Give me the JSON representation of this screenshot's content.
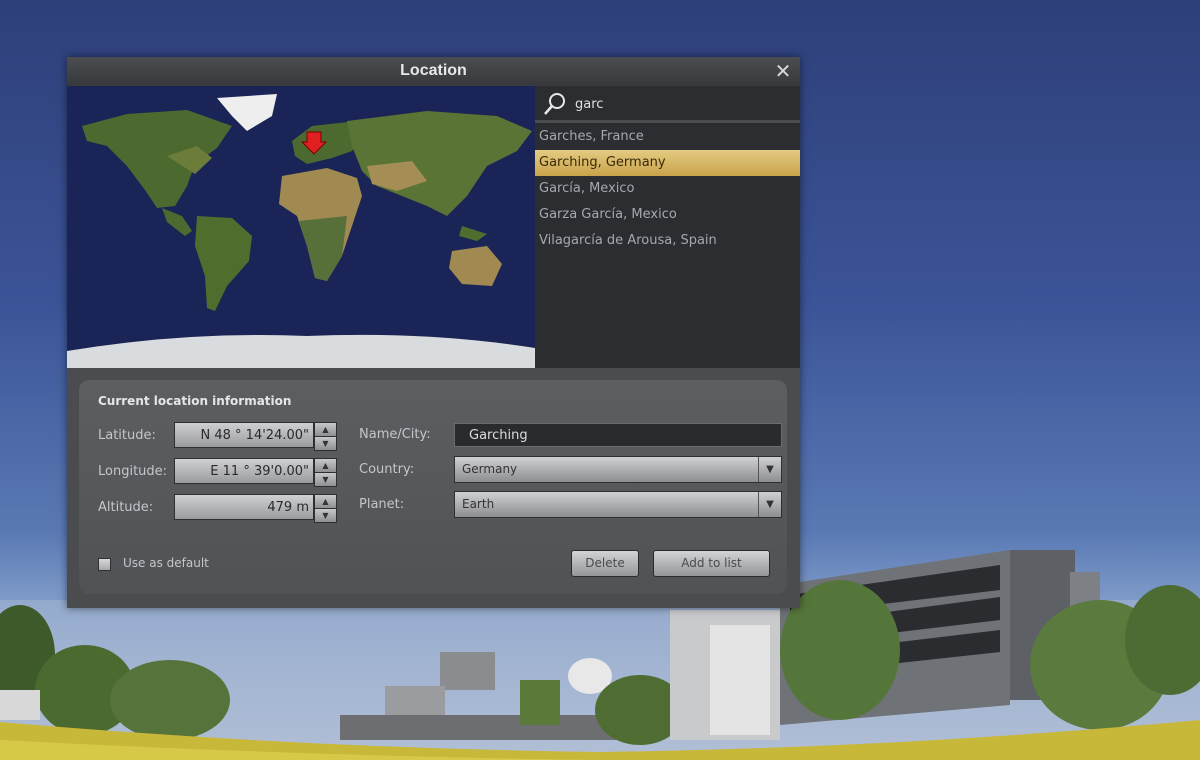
{
  "dialog": {
    "title": "Location",
    "close_glyph": "✕"
  },
  "search": {
    "query": "garc",
    "results": [
      "Garches, France",
      "Garching, Germany",
      "García, Mexico",
      "Garza García, Mexico",
      "Vilagarcía de Arousa, Spain"
    ],
    "selected_result": "Garching, Germany"
  },
  "info": {
    "group_title": "Current location information",
    "latitude_label": "Latitude:",
    "latitude_value": "N 48 ° 14'24.00\"",
    "longitude_label": "Longitude:",
    "longitude_value": "E 11 ° 39'0.00\"",
    "altitude_label": "Altitude:",
    "altitude_value": "479 m",
    "name_label": "Name/City:",
    "name_value": "Garching",
    "country_label": "Country:",
    "country_value": "Germany",
    "planet_label": "Planet:",
    "planet_value": "Earth",
    "default_label": "Use as default",
    "delete_label": "Delete",
    "add_label": "Add to list"
  },
  "icons": {
    "search": "search-icon",
    "close": "close-icon",
    "marker": "location-marker-icon",
    "spin_up": "chevron-up-icon",
    "spin_down": "chevron-down-icon",
    "combo_arrow": "chevron-down-icon"
  },
  "colors": {
    "selection_gold": "#d8b764",
    "marker_red": "#e02020",
    "ocean": "#1b2456"
  }
}
